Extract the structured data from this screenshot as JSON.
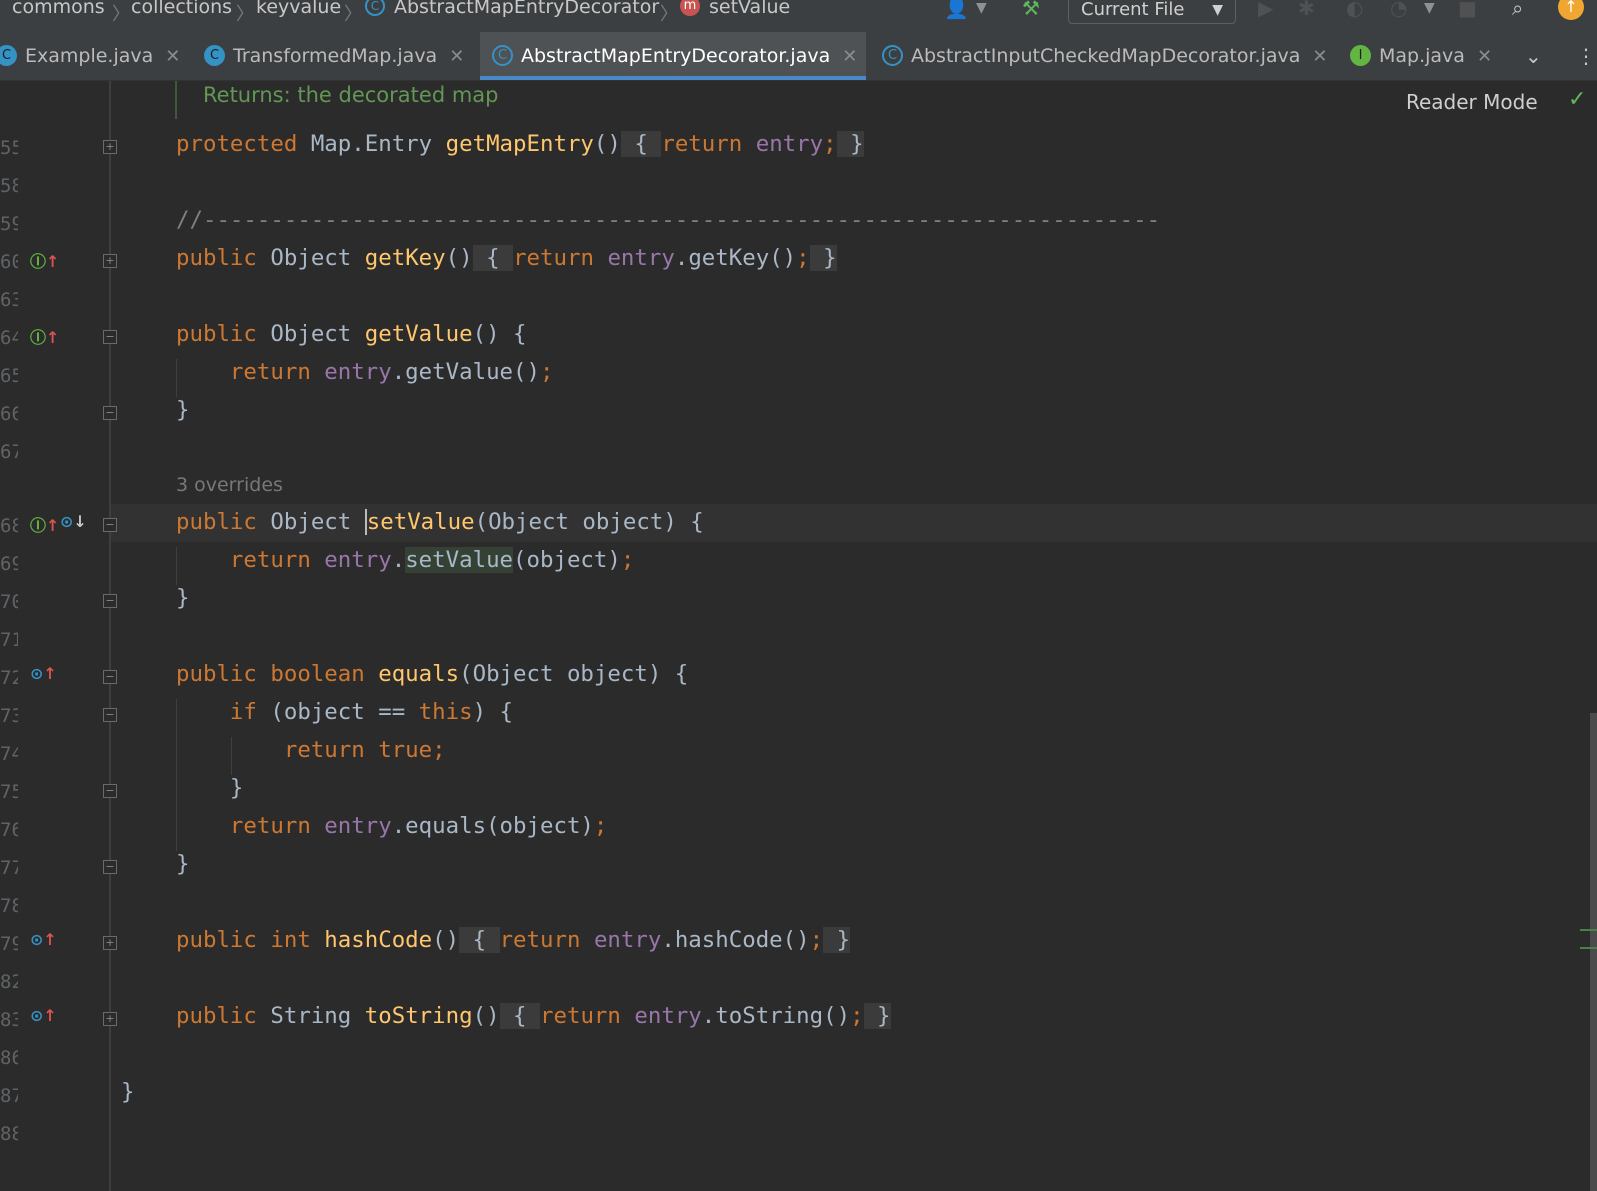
{
  "breadcrumb": {
    "items": [
      "commons",
      "collections",
      "keyvalue",
      "AbstractMapEntryDecorator",
      "setValue"
    ]
  },
  "toolbar": {
    "run_config": "Current File"
  },
  "tabs": [
    {
      "label": "Example.java",
      "icon": "class-run-icon"
    },
    {
      "label": "TransformedMap.java",
      "icon": "class-icon"
    },
    {
      "label": "AbstractMapEntryDecorator.java",
      "icon": "abstract-class-icon",
      "active": true
    },
    {
      "label": "AbstractInputCheckedMapDecorator.java",
      "icon": "abstract-class-icon"
    },
    {
      "label": "Map.java",
      "icon": "interface-icon"
    }
  ],
  "editor": {
    "doc_returns": "Returns: the decorated map",
    "reader_mode": "Reader Mode",
    "overrides_hint": "3 overrides",
    "line_numbers": [
      "55",
      "58",
      "59",
      "60",
      "63",
      "64",
      "65",
      "66",
      "67",
      "68",
      "69",
      "70",
      "71",
      "72",
      "73",
      "74",
      "75",
      "76",
      "77",
      "78",
      "79",
      "82",
      "83",
      "86",
      "87",
      "88"
    ]
  },
  "colors": {
    "keyword": "#cc7832",
    "method": "#ffc66d",
    "field": "#9876aa",
    "comment": "#808080",
    "accent_tab": "#4a88c7"
  }
}
